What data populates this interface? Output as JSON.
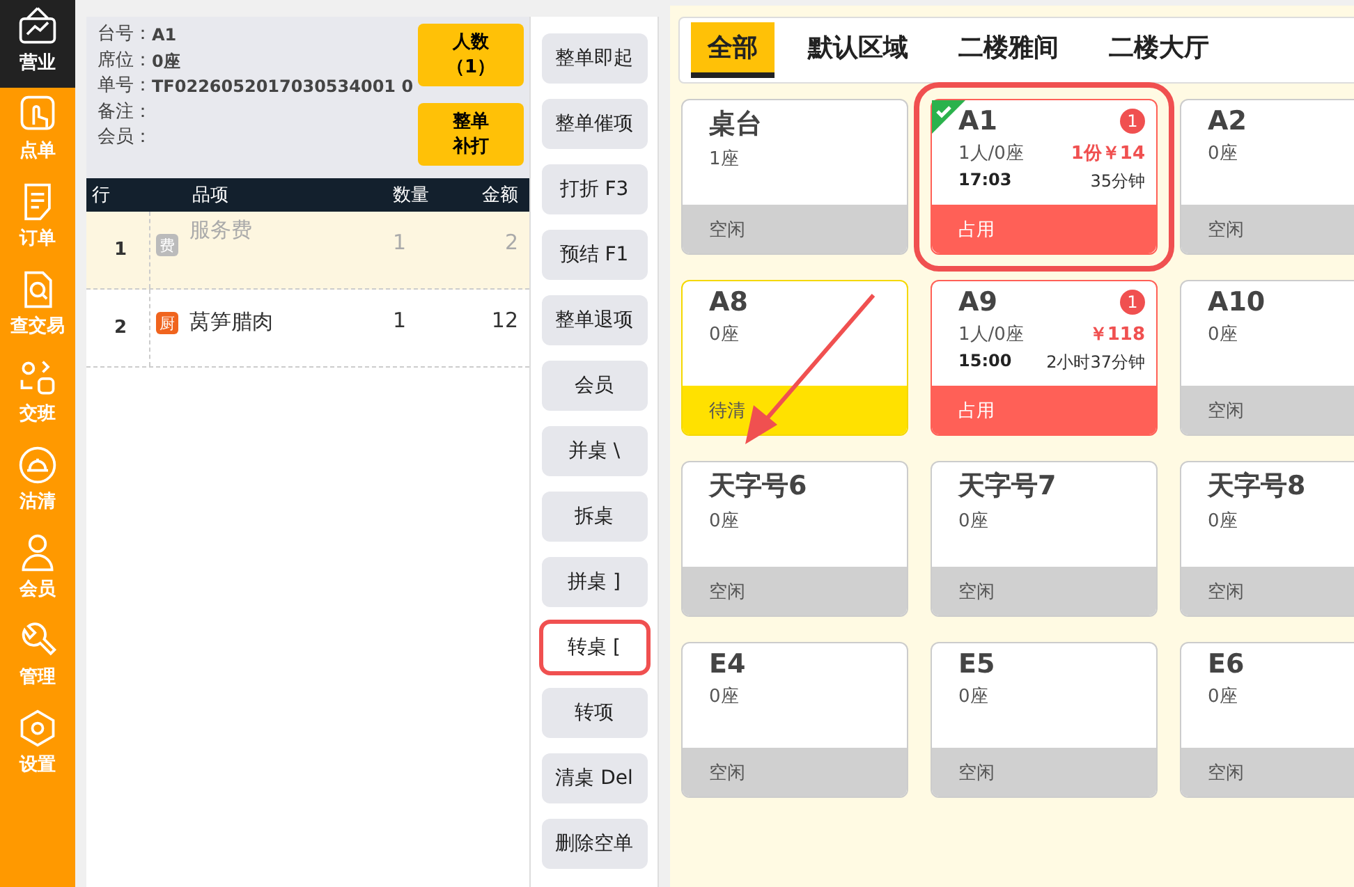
{
  "sidebar": {
    "items": [
      {
        "label": "营业",
        "selected": true
      },
      {
        "label": "点单",
        "selected": false
      },
      {
        "label": "订单",
        "selected": false
      },
      {
        "label": "查交易",
        "selected": false
      },
      {
        "label": "交班",
        "selected": false
      },
      {
        "label": "沽清",
        "selected": false
      },
      {
        "label": "会员",
        "selected": false
      },
      {
        "label": "管理",
        "selected": false
      },
      {
        "label": "设置",
        "selected": false
      }
    ]
  },
  "order": {
    "fields": [
      {
        "label": "台号：",
        "value": "A1"
      },
      {
        "label": "席位：",
        "value": "0座"
      },
      {
        "label": "单号：",
        "value": "TF0226052017030534001 0"
      },
      {
        "label": "备注："
      },
      {
        "label": "会员："
      }
    ],
    "buttons": [
      {
        "lines": [
          "人数",
          "（1）"
        ]
      },
      {
        "lines": [
          "整单",
          "补打"
        ]
      }
    ],
    "columns": [
      "行",
      "品项",
      "数量",
      "金额"
    ],
    "rows": [
      {
        "line": "1",
        "tag": "费",
        "kind": "fee",
        "name": "服务费",
        "qty": "1",
        "amount": "2",
        "selected": true
      },
      {
        "line": "2",
        "tag": "厨",
        "kind": "kitchen",
        "name": "莴笋腊肉",
        "qty": "1",
        "amount": "12",
        "selected": false
      }
    ]
  },
  "actions": [
    {
      "label": "整单即起",
      "annotated": false
    },
    {
      "label": "整单催项",
      "annotated": false
    },
    {
      "label": "打折 F3",
      "annotated": false
    },
    {
      "label": "预结 F1",
      "annotated": false
    },
    {
      "label": "整单退项",
      "annotated": false
    },
    {
      "label": "会员",
      "annotated": false
    },
    {
      "label": "并桌 \\",
      "annotated": false
    },
    {
      "label": "拆桌",
      "annotated": false
    },
    {
      "label": "拼桌 ]",
      "annotated": false
    },
    {
      "label": "转桌 [",
      "annotated": true
    },
    {
      "label": "转项",
      "annotated": false
    },
    {
      "label": "清桌 Del",
      "annotated": false
    },
    {
      "label": "删除空单",
      "annotated": false
    }
  ],
  "tabs": [
    {
      "label": "全部",
      "selected": true
    },
    {
      "label": "默认区域",
      "selected": false
    },
    {
      "label": "二楼雅间",
      "selected": false
    },
    {
      "label": "二楼大厅",
      "selected": false
    }
  ],
  "tables": [
    {
      "name": "桌台",
      "seats": "1座",
      "status": "空闲",
      "kind": "idle",
      "selected": false,
      "annotated": false
    },
    {
      "name": "A1",
      "seats": "1人/0座",
      "amount": "1份￥14",
      "time": "17:03",
      "duration": "35分钟",
      "badge": "1",
      "status": "占用",
      "kind": "occupied",
      "selected": true,
      "annotated": true
    },
    {
      "name": "A2",
      "seats": "0座",
      "status": "空闲",
      "kind": "idle",
      "selected": false,
      "annotated": false
    },
    {
      "name": "A8",
      "seats": "0座",
      "status": "待清",
      "kind": "pending",
      "selected": false,
      "annotated": false
    },
    {
      "name": "A9",
      "seats": "1人/0座",
      "amount": "￥118",
      "time": "15:00",
      "duration": "2小时37分钟",
      "badge": "1",
      "status": "占用",
      "kind": "occupied",
      "selected": false,
      "annotated": false
    },
    {
      "name": "A10",
      "seats": "0座",
      "status": "空闲",
      "kind": "idle",
      "selected": false,
      "annotated": false
    },
    {
      "name": "天字号6",
      "seats": "0座",
      "status": "空闲",
      "kind": "idle",
      "selected": false,
      "annotated": false
    },
    {
      "name": "天字号7",
      "seats": "0座",
      "status": "空闲",
      "kind": "idle",
      "selected": false,
      "annotated": false
    },
    {
      "name": "天字号8",
      "seats": "0座",
      "status": "空闲",
      "kind": "idle",
      "selected": false,
      "annotated": false
    },
    {
      "name": "E4",
      "seats": "0座",
      "status": "空闲",
      "kind": "idle",
      "selected": false,
      "annotated": false
    },
    {
      "name": "E5",
      "seats": "0座",
      "status": "空闲",
      "kind": "idle",
      "selected": false,
      "annotated": false
    },
    {
      "name": "E6",
      "seats": "0座",
      "status": "空闲",
      "kind": "idle",
      "selected": false,
      "annotated": false
    }
  ]
}
